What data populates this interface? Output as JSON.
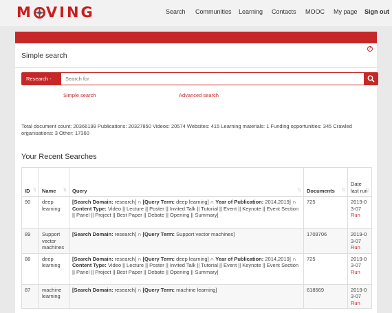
{
  "brand": {
    "name": "MOVING"
  },
  "nav": {
    "search": "Search",
    "communities": "Communities",
    "learning": "Learning",
    "contacts": "Contacts",
    "mooc": "MOOC",
    "mypage": "My page",
    "signout": "Sign out"
  },
  "panel": {
    "title": "Simple search",
    "help": "?"
  },
  "search": {
    "domain_label": "Research -",
    "placeholder": "Search for",
    "simple_link": "Simple search",
    "advanced_link": "Advanced search"
  },
  "counts_text": "Total document count: 20366199 Publications: 20327850 Videos: 20574 Websites: 415 Learning materials: 1 Funding opportunities: 345 Crawled organisations: 3 Other: 17360",
  "recent": {
    "title": "Your Recent Searches",
    "columns": [
      "ID",
      "Name",
      "Query",
      "Documents",
      "Date last run"
    ],
    "rows": [
      {
        "id": "90",
        "name": "deep learning",
        "q": [
          "[Search Domain:",
          " research] ∩ ",
          "[Query Term:",
          " deep learning] ∩ ",
          "Year of Publication:",
          " 2014,2019] ∩ ",
          "Content Type:",
          " Video || Lecture || Poster || Invited Talk || Tutorial || Event || Keynote || Event Section || Panel || Project || Best Paper || Debate || Opening || Summary]"
        ],
        "documents": "725",
        "date": "2019-03-07",
        "run": "Run"
      },
      {
        "id": "89",
        "name": "Support vector machines",
        "q": [
          "[Search Domain:",
          " research] ∩ ",
          "[Query Term:",
          " Support vector machines]"
        ],
        "documents": "1709706",
        "date": "2019-03-07",
        "run": "Run"
      },
      {
        "id": "88",
        "name": "deep learning",
        "q": [
          "[Search Domain:",
          " research] ∩ ",
          "[Query Term:",
          " deep learning] ∩ ",
          "Year of Publication:",
          " 2014,2019] ∩ ",
          "Content Type:",
          " Video || Lecture || Poster || Invited Talk || Tutorial || Event || Keynote || Event Section || Panel || Project || Best Paper || Debate || Opening || Summary]"
        ],
        "documents": "725",
        "date": "2019-03-07",
        "run": "Run"
      },
      {
        "id": "87",
        "name": "machine learning",
        "q": [
          "[Search Domain:",
          " research] ∩ ",
          "[Query Term:",
          " machine learning]"
        ],
        "documents": "618569",
        "date": "2019-03-07",
        "run": "Run"
      }
    ]
  },
  "colors": {
    "accent": "#c62828"
  }
}
